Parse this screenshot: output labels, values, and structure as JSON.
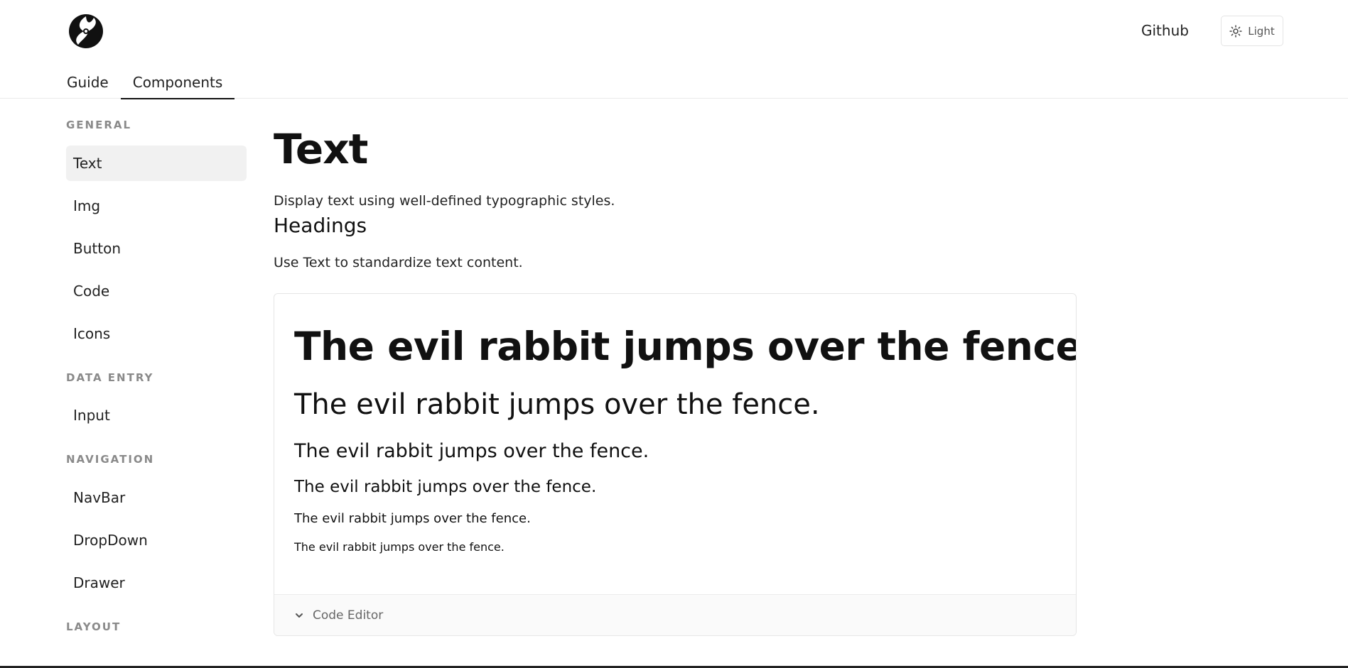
{
  "header": {
    "github_label": "Github",
    "theme_label": "Light",
    "tabs": [
      {
        "label": "Guide"
      },
      {
        "label": "Components"
      }
    ]
  },
  "sidebar": {
    "sections": [
      {
        "title": "GENERAL",
        "items": [
          "Text",
          "Img",
          "Button",
          "Code",
          "Icons"
        ]
      },
      {
        "title": "DATA ENTRY",
        "items": [
          "Input"
        ]
      },
      {
        "title": "NAVIGATION",
        "items": [
          "NavBar",
          "DropDown",
          "Drawer"
        ]
      },
      {
        "title": "LAYOUT",
        "items": []
      }
    ],
    "active_item": "Text"
  },
  "main": {
    "title": "Text",
    "description": "Display text using well-defined typographic styles.",
    "subheading": "Headings",
    "subdescription": "Use Text to standardize text content.",
    "samples": [
      "The evil rabbit jumps over the fence.",
      "The evil rabbit jumps over the fence.",
      "The evil rabbit jumps over the fence.",
      "The evil rabbit jumps over the fence.",
      "The evil rabbit jumps over the fence.",
      "The evil rabbit jumps over the fence."
    ],
    "code_editor_label": "Code Editor"
  },
  "colors": {
    "accent": "#111111",
    "active_bg": "#f1f1f1",
    "section_title": "#8a8a8a",
    "border": "#eaeaea"
  }
}
